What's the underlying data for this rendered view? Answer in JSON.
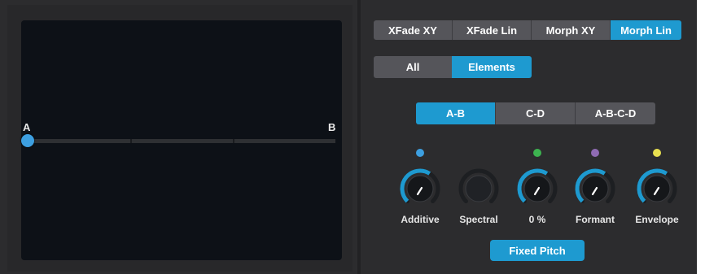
{
  "blend_modes": {
    "items": [
      {
        "label": "XFade XY",
        "active": false
      },
      {
        "label": "XFade Lin",
        "active": false
      },
      {
        "label": "Morph XY",
        "active": false
      },
      {
        "label": "Morph Lin",
        "active": true
      }
    ]
  },
  "scope": {
    "items": [
      {
        "label": "All",
        "active": false
      },
      {
        "label": "Elements",
        "active": true
      }
    ]
  },
  "pairs": {
    "items": [
      {
        "label": "A-B",
        "active": true
      },
      {
        "label": "C-D",
        "active": false
      },
      {
        "label": "A-B-C-D",
        "active": false
      }
    ]
  },
  "pad": {
    "label_a": "A",
    "label_b": "B",
    "morph_position": 0.0
  },
  "knobs": [
    {
      "label": "Additive",
      "color": "#3d9fe0",
      "level": 0.62,
      "has_dot": true
    },
    {
      "label": "Spectral",
      "color": "#3d9fe0",
      "level": 0.0,
      "has_dot": false
    },
    {
      "label": "0 %",
      "color": "#3db350",
      "level": 0.62,
      "has_dot": true
    },
    {
      "label": "Formant",
      "color": "#8f6bb3",
      "level": 0.62,
      "has_dot": true
    },
    {
      "label": "Envelope",
      "color": "#e8e050",
      "level": 0.62,
      "has_dot": true
    }
  ],
  "fixed_pitch": {
    "label": "Fixed Pitch"
  },
  "accent_color": "#1e9ad0"
}
